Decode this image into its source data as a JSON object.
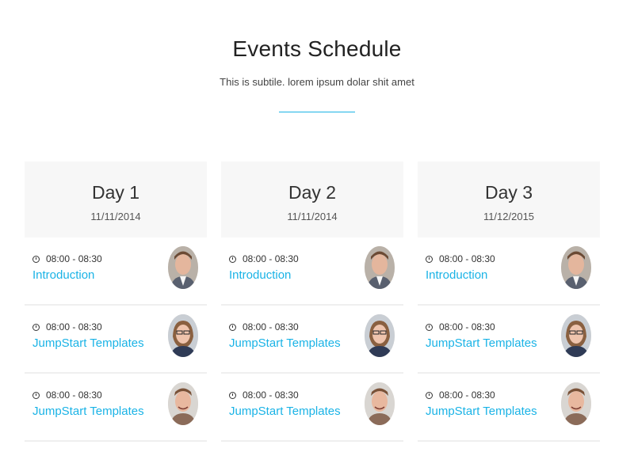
{
  "header": {
    "title": "Events Schedule",
    "subtitle": "This is subtile. lorem ipsum dolar shit amet"
  },
  "colors": {
    "accent": "#1ab3e6",
    "panel": "#f7f7f7"
  },
  "days": [
    {
      "label": "Day 1",
      "date": "11/11/2014",
      "sessions": [
        {
          "time": "08:00 - 08:30",
          "title": "Introduction",
          "icon": "clock-icon"
        },
        {
          "time": "08:00 - 08:30",
          "title": "JumpStart Templates",
          "icon": "clock-icon"
        },
        {
          "time": "08:00 - 08:30",
          "title": "JumpStart Templates",
          "icon": "clock-icon"
        }
      ]
    },
    {
      "label": "Day 2",
      "date": "11/11/2014",
      "sessions": [
        {
          "time": "08:00 - 08:30",
          "title": "Introduction",
          "icon": "clock-icon"
        },
        {
          "time": "08:00 - 08:30",
          "title": "JumpStart Templates",
          "icon": "clock-icon"
        },
        {
          "time": "08:00 - 08:30",
          "title": "JumpStart Templates",
          "icon": "clock-icon"
        }
      ]
    },
    {
      "label": "Day 3",
      "date": "11/12/2015",
      "sessions": [
        {
          "time": "08:00 - 08:30",
          "title": "Introduction",
          "icon": "clock-icon"
        },
        {
          "time": "08:00 - 08:30",
          "title": "JumpStart Templates",
          "icon": "clock-icon"
        },
        {
          "time": "08:00 - 08:30",
          "title": "JumpStart Templates",
          "icon": "clock-icon"
        }
      ]
    }
  ]
}
